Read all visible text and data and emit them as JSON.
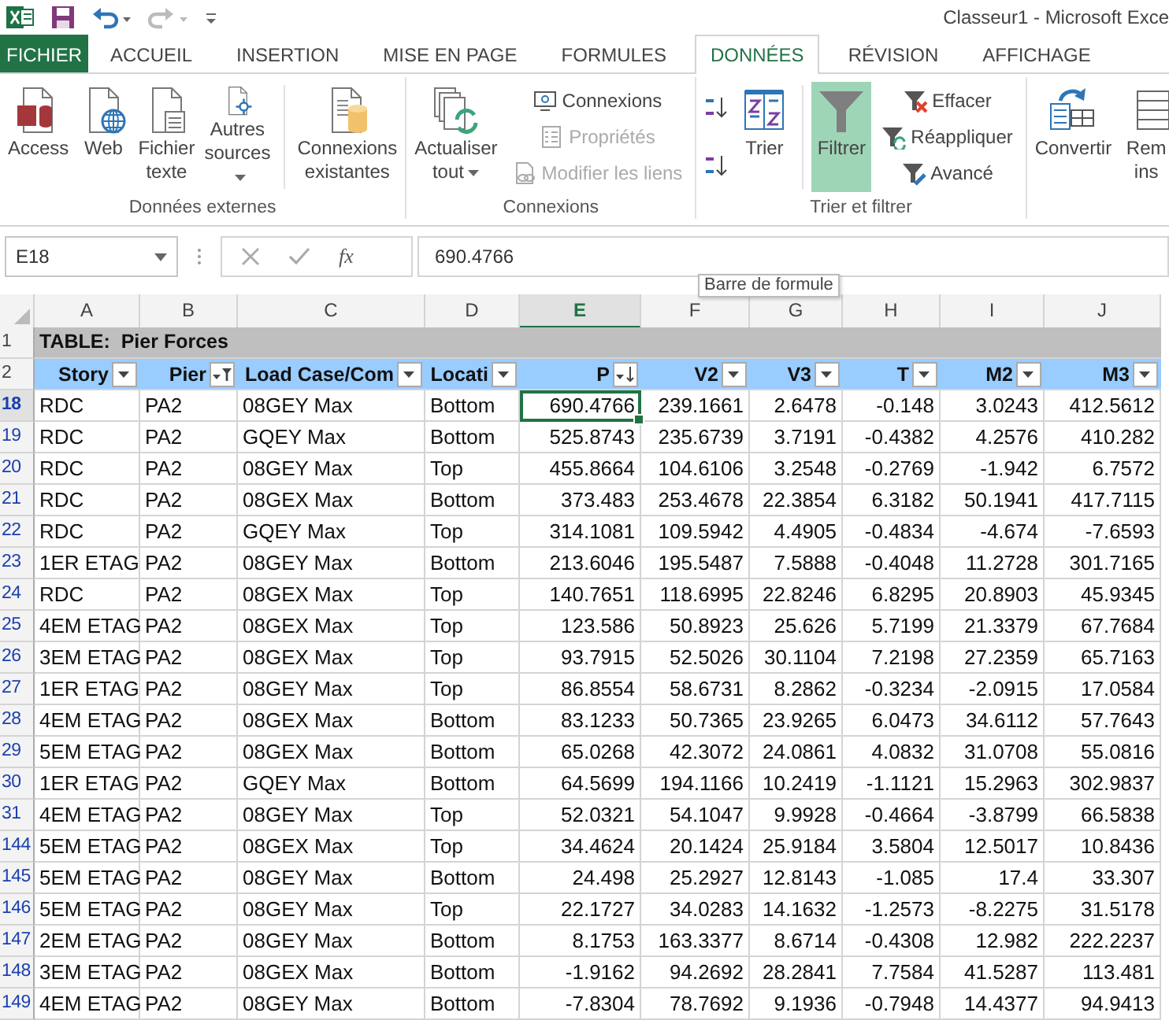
{
  "window": {
    "title": "Classeur1 - Microsoft Exce"
  },
  "tabs": [
    {
      "label": "FICHIER",
      "kind": "file",
      "selected": false
    },
    {
      "label": "ACCUEIL",
      "kind": "tab",
      "selected": false
    },
    {
      "label": "INSERTION",
      "kind": "tab",
      "selected": false
    },
    {
      "label": "MISE EN PAGE",
      "kind": "tab",
      "selected": false
    },
    {
      "label": "FORMULES",
      "kind": "tab",
      "selected": false
    },
    {
      "label": "DONNÉES",
      "kind": "tab",
      "selected": true
    },
    {
      "label": "RÉVISION",
      "kind": "tab",
      "selected": false
    },
    {
      "label": "AFFICHAGE",
      "kind": "tab",
      "selected": false
    }
  ],
  "ribbon": {
    "groups": [
      {
        "label": "Données externes",
        "items": [
          {
            "kind": "large",
            "label": "Access",
            "dropdown": false,
            "on": false,
            "disabled": false
          },
          {
            "kind": "large",
            "label": "Web",
            "dropdown": false,
            "on": false,
            "disabled": false
          },
          {
            "kind": "large",
            "label": "Fichier texte",
            "dropdown": false,
            "on": false,
            "disabled": false
          },
          {
            "kind": "large",
            "label": "Autres sources",
            "dropdown": true,
            "on": false,
            "disabled": false
          },
          {
            "kind": "separator"
          },
          {
            "kind": "large",
            "label": "Connexions existantes",
            "dropdown": false,
            "on": false,
            "disabled": false
          }
        ]
      },
      {
        "label": "Connexions",
        "items": [
          {
            "kind": "large",
            "label": "Actualiser tout",
            "dropdown": true,
            "on": false,
            "disabled": false
          },
          {
            "kind": "small",
            "label": "Connexions",
            "disabled": false
          },
          {
            "kind": "small",
            "label": "Propriétés",
            "disabled": true
          },
          {
            "kind": "small",
            "label": "Modifier les liens",
            "disabled": true
          }
        ]
      },
      {
        "label": "Trier et filtrer",
        "items": [
          {
            "kind": "icon"
          },
          {
            "kind": "icon"
          },
          {
            "kind": "large",
            "label": "Trier",
            "dropdown": false,
            "on": false,
            "disabled": false
          },
          {
            "kind": "separator"
          },
          {
            "kind": "large",
            "label": "Filtrer",
            "dropdown": false,
            "on": true,
            "disabled": false
          },
          {
            "kind": "small",
            "label": "Effacer",
            "disabled": false
          },
          {
            "kind": "small",
            "label": "Réappliquer",
            "disabled": false
          },
          {
            "kind": "small",
            "label": "Avancé",
            "disabled": false
          }
        ]
      },
      {
        "items": [
          {
            "kind": "large",
            "label": "Convertir",
            "dropdown": false,
            "on": false,
            "disabled": false
          },
          {
            "kind": "large",
            "label": "Rem ins",
            "dropdown": false,
            "on": false,
            "disabled": false
          }
        ]
      }
    ]
  },
  "formula_bar": {
    "name_box": "E18",
    "function_button": "fx",
    "value": "690.4766",
    "tooltip": "Barre de formule"
  },
  "sheet": {
    "columns": [
      {
        "label": "A",
        "selected": false
      },
      {
        "label": "B",
        "selected": false
      },
      {
        "label": "C",
        "selected": false
      },
      {
        "label": "D",
        "selected": false
      },
      {
        "label": "E",
        "selected": true
      },
      {
        "label": "F",
        "selected": false
      },
      {
        "label": "G",
        "selected": false
      },
      {
        "label": "H",
        "selected": false
      },
      {
        "label": "I",
        "selected": false
      },
      {
        "label": "J",
        "selected": false
      }
    ],
    "title_row": {
      "row": "1",
      "text": "TABLE:  Pier Forces"
    },
    "header_row": "2",
    "headers": [
      {
        "label": "Story",
        "filtered": false,
        "sorted": false
      },
      {
        "label": "Pier",
        "filtered": true,
        "sorted": false
      },
      {
        "label": "Load Case/Com",
        "filtered": false,
        "sorted": false
      },
      {
        "label": "Locati",
        "filtered": false,
        "sorted": false
      },
      {
        "label": "P",
        "filtered": false,
        "sorted": true
      },
      {
        "label": "V2",
        "filtered": false,
        "sorted": false
      },
      {
        "label": "V3",
        "filtered": false,
        "sorted": false
      },
      {
        "label": "T",
        "filtered": false,
        "sorted": false
      },
      {
        "label": "M2",
        "filtered": false,
        "sorted": false
      },
      {
        "label": "M3",
        "filtered": false,
        "sorted": false
      }
    ],
    "rows": [
      {
        "row": "18",
        "selected": true,
        "cells": [
          "RDC",
          "PA2",
          "08GEY Max",
          "Bottom",
          "690.4766",
          "239.1661",
          "2.6478",
          "-0.148",
          "3.0243",
          "412.5612"
        ]
      },
      {
        "row": "19",
        "selected": false,
        "cells": [
          "RDC",
          "PA2",
          "GQEY Max",
          "Bottom",
          "525.8743",
          "235.6739",
          "3.7191",
          "-0.4382",
          "4.2576",
          "410.282"
        ]
      },
      {
        "row": "20",
        "selected": false,
        "cells": [
          "RDC",
          "PA2",
          "08GEY Max",
          "Top",
          "455.8664",
          "104.6106",
          "3.2548",
          "-0.2769",
          "-1.942",
          "6.7572"
        ]
      },
      {
        "row": "21",
        "selected": false,
        "cells": [
          "RDC",
          "PA2",
          "08GEX Max",
          "Bottom",
          "373.483",
          "253.4678",
          "22.3854",
          "6.3182",
          "50.1941",
          "417.7115"
        ]
      },
      {
        "row": "22",
        "selected": false,
        "cells": [
          "RDC",
          "PA2",
          "GQEY Max",
          "Top",
          "314.1081",
          "109.5942",
          "4.4905",
          "-0.4834",
          "-4.674",
          "-7.6593"
        ]
      },
      {
        "row": "23",
        "selected": false,
        "cells": [
          "1ER ETAG",
          "PA2",
          "08GEY Max",
          "Bottom",
          "213.6046",
          "195.5487",
          "7.5888",
          "-0.4048",
          "11.2728",
          "301.7165"
        ]
      },
      {
        "row": "24",
        "selected": false,
        "cells": [
          "RDC",
          "PA2",
          "08GEX Max",
          "Top",
          "140.7651",
          "118.6995",
          "22.8246",
          "6.8295",
          "20.8903",
          "45.9345"
        ]
      },
      {
        "row": "25",
        "selected": false,
        "cells": [
          "4EM ETAG",
          "PA2",
          "08GEX Max",
          "Top",
          "123.586",
          "50.8923",
          "25.626",
          "5.7199",
          "21.3379",
          "67.7684"
        ]
      },
      {
        "row": "26",
        "selected": false,
        "cells": [
          "3EM ETAG",
          "PA2",
          "08GEX Max",
          "Top",
          "93.7915",
          "52.5026",
          "30.1104",
          "7.2198",
          "27.2359",
          "65.7163"
        ]
      },
      {
        "row": "27",
        "selected": false,
        "cells": [
          "1ER ETAG",
          "PA2",
          "08GEY Max",
          "Top",
          "86.8554",
          "58.6731",
          "8.2862",
          "-0.3234",
          "-2.0915",
          "17.0584"
        ]
      },
      {
        "row": "28",
        "selected": false,
        "cells": [
          "4EM ETAG",
          "PA2",
          "08GEX Max",
          "Bottom",
          "83.1233",
          "50.7365",
          "23.9265",
          "6.0473",
          "34.6112",
          "57.7643"
        ]
      },
      {
        "row": "29",
        "selected": false,
        "cells": [
          "5EM ETAG",
          "PA2",
          "08GEX Max",
          "Bottom",
          "65.0268",
          "42.3072",
          "24.0861",
          "4.0832",
          "31.0708",
          "55.0816"
        ]
      },
      {
        "row": "30",
        "selected": false,
        "cells": [
          "1ER ETAG",
          "PA2",
          "GQEY Max",
          "Bottom",
          "64.5699",
          "194.1166",
          "10.2419",
          "-1.1121",
          "15.2963",
          "302.9837"
        ]
      },
      {
        "row": "31",
        "selected": false,
        "cells": [
          "4EM ETAG",
          "PA2",
          "08GEY Max",
          "Top",
          "52.0321",
          "54.1047",
          "9.9928",
          "-0.4664",
          "-3.8799",
          "66.5838"
        ]
      },
      {
        "row": "144",
        "selected": false,
        "cells": [
          "5EM ETAG",
          "PA2",
          "08GEX Max",
          "Top",
          "34.4624",
          "20.1424",
          "25.9184",
          "3.5804",
          "12.5017",
          "10.8436"
        ]
      },
      {
        "row": "145",
        "selected": false,
        "cells": [
          "5EM ETAG",
          "PA2",
          "08GEY Max",
          "Bottom",
          "24.498",
          "25.2927",
          "12.8143",
          "-1.085",
          "17.4",
          "33.307"
        ]
      },
      {
        "row": "146",
        "selected": false,
        "cells": [
          "5EM ETAG",
          "PA2",
          "08GEY Max",
          "Top",
          "22.1727",
          "34.0283",
          "14.1632",
          "-1.2573",
          "-8.2275",
          "31.5178"
        ]
      },
      {
        "row": "147",
        "selected": false,
        "cells": [
          "2EM ETAG",
          "PA2",
          "08GEY Max",
          "Bottom",
          "8.1753",
          "163.3377",
          "8.6714",
          "-0.4308",
          "12.982",
          "222.2237"
        ]
      },
      {
        "row": "148",
        "selected": false,
        "cells": [
          "3EM ETAG",
          "PA2",
          "08GEX Max",
          "Bottom",
          "-1.9162",
          "94.2692",
          "28.2841",
          "7.7584",
          "41.5287",
          "113.481"
        ]
      },
      {
        "row": "149",
        "selected": false,
        "cells": [
          "4EM ETAG",
          "PA2",
          "08GEY Max",
          "Bottom",
          "-7.8304",
          "78.7692",
          "9.1936",
          "-0.7948",
          "14.4377",
          "94.9413"
        ]
      }
    ]
  }
}
